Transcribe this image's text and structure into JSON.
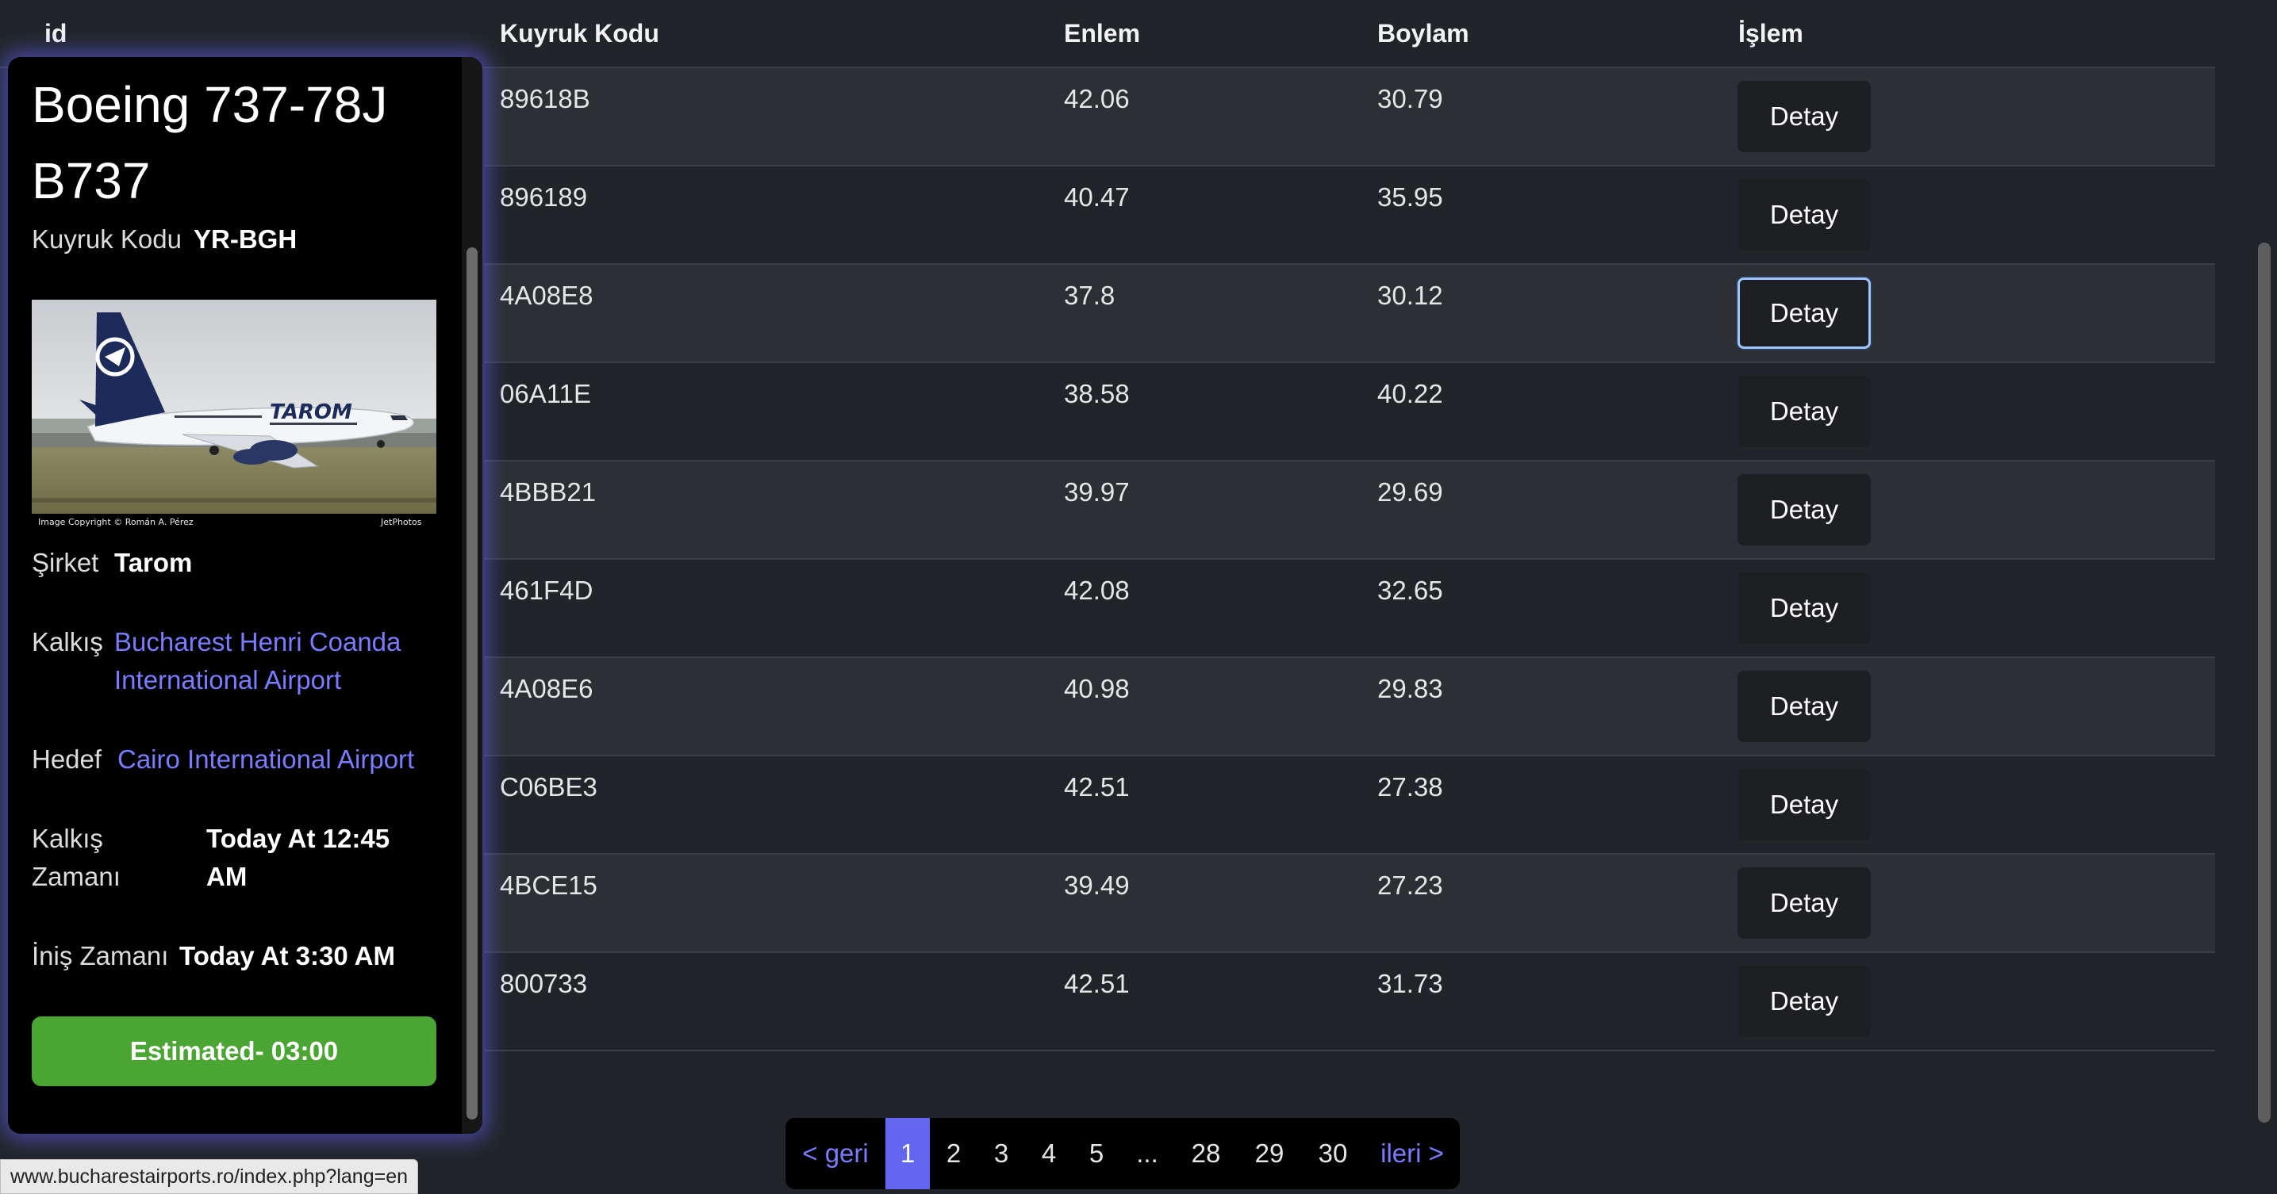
{
  "table": {
    "headers": {
      "id": "id",
      "tail_code": "Kuyruk Kodu",
      "lat": "Enlem",
      "lon": "Boylam",
      "action": "İşlem"
    },
    "rows": [
      {
        "code": "89618B",
        "lat": "42.06",
        "lon": "30.79",
        "action": "Detay"
      },
      {
        "code": "896189",
        "lat": "40.47",
        "lon": "35.95",
        "action": "Detay"
      },
      {
        "code": "4A08E8",
        "lat": "37.8",
        "lon": "30.12",
        "action": "Detay"
      },
      {
        "code": "06A11E",
        "lat": "38.58",
        "lon": "40.22",
        "action": "Detay"
      },
      {
        "code": "4BBB21",
        "lat": "39.97",
        "lon": "29.69",
        "action": "Detay"
      },
      {
        "code": "461F4D",
        "lat": "42.08",
        "lon": "32.65",
        "action": "Detay"
      },
      {
        "code": "4A08E6",
        "lat": "40.98",
        "lon": "29.83",
        "action": "Detay"
      },
      {
        "code": "C06BE3",
        "lat": "42.51",
        "lon": "27.38",
        "action": "Detay"
      },
      {
        "code": "4BCE15",
        "lat": "39.49",
        "lon": "27.23",
        "action": "Detay"
      },
      {
        "code": "800733",
        "lat": "42.51",
        "lon": "31.73",
        "action": "Detay"
      }
    ]
  },
  "card": {
    "title_line1": "Boeing 737-78J",
    "title_line2": "B737",
    "tail_label": "Kuyruk Kodu",
    "tail_value": "YR-BGH",
    "photo_credit_left": "Image Copyright © Román A. Pérez",
    "photo_credit_right": "JetPhotos",
    "photo_livery": "TAROM",
    "airline_label": "Şirket",
    "airline_value": "Tarom",
    "departure_label": "Kalkış",
    "departure_line1": "Bucharest Henri Coanda",
    "departure_line2": "International Airport",
    "destination_label": "Hedef",
    "destination_value": "Cairo International Airport",
    "dep_time_label_line1": "Kalkış",
    "dep_time_label_line2": "Zamanı",
    "dep_time_line1": "Today At 12:45",
    "dep_time_line2": "AM",
    "arr_time_label": "İniş Zamanı",
    "arr_time_value": "Today At 3:30 AM",
    "status": "Estimated- 03:00",
    "status_color": "#4aa532"
  },
  "pagination": {
    "prev": "< geri",
    "pages": [
      "1",
      "2",
      "3",
      "4",
      "5",
      "...",
      "28",
      "29",
      "30"
    ],
    "active": "1",
    "next": "ileri >",
    "accent": "#6366f1"
  },
  "statusbar": {
    "url": "www.bucharestairports.ro/index.php?lang=en"
  }
}
